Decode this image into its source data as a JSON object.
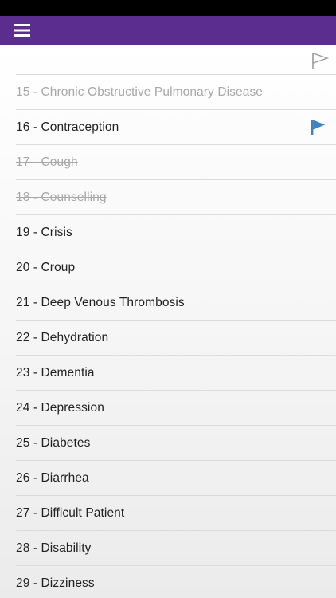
{
  "colors": {
    "header": "#5b2d8e",
    "status_bar": "#000000",
    "flag_active": "#3c83c1",
    "done_text": "#a8a8a8"
  },
  "header": {
    "menu_icon": "hamburger-menu-icon"
  },
  "filter": {
    "icon": "flag-outline-icon"
  },
  "items": [
    {
      "label": "15 - Chronic Obstructive Pulmonary Disease",
      "done": true,
      "flagged": false
    },
    {
      "label": "16 - Contraception",
      "done": false,
      "flagged": true
    },
    {
      "label": "17 - Cough",
      "done": true,
      "flagged": false
    },
    {
      "label": "18 - Counselling",
      "done": true,
      "flagged": false
    },
    {
      "label": "19 - Crisis",
      "done": false,
      "flagged": false
    },
    {
      "label": "20 - Croup",
      "done": false,
      "flagged": false
    },
    {
      "label": "21 - Deep Venous Thrombosis",
      "done": false,
      "flagged": false
    },
    {
      "label": "22 - Dehydration",
      "done": false,
      "flagged": false
    },
    {
      "label": "23 - Dementia",
      "done": false,
      "flagged": false
    },
    {
      "label": "24 - Depression",
      "done": false,
      "flagged": false
    },
    {
      "label": "25 - Diabetes",
      "done": false,
      "flagged": false
    },
    {
      "label": "26 - Diarrhea",
      "done": false,
      "flagged": false
    },
    {
      "label": "27 - Difficult Patient",
      "done": false,
      "flagged": false
    },
    {
      "label": "28 - Disability",
      "done": false,
      "flagged": false
    },
    {
      "label": "29 - Dizziness",
      "done": false,
      "flagged": false
    }
  ]
}
